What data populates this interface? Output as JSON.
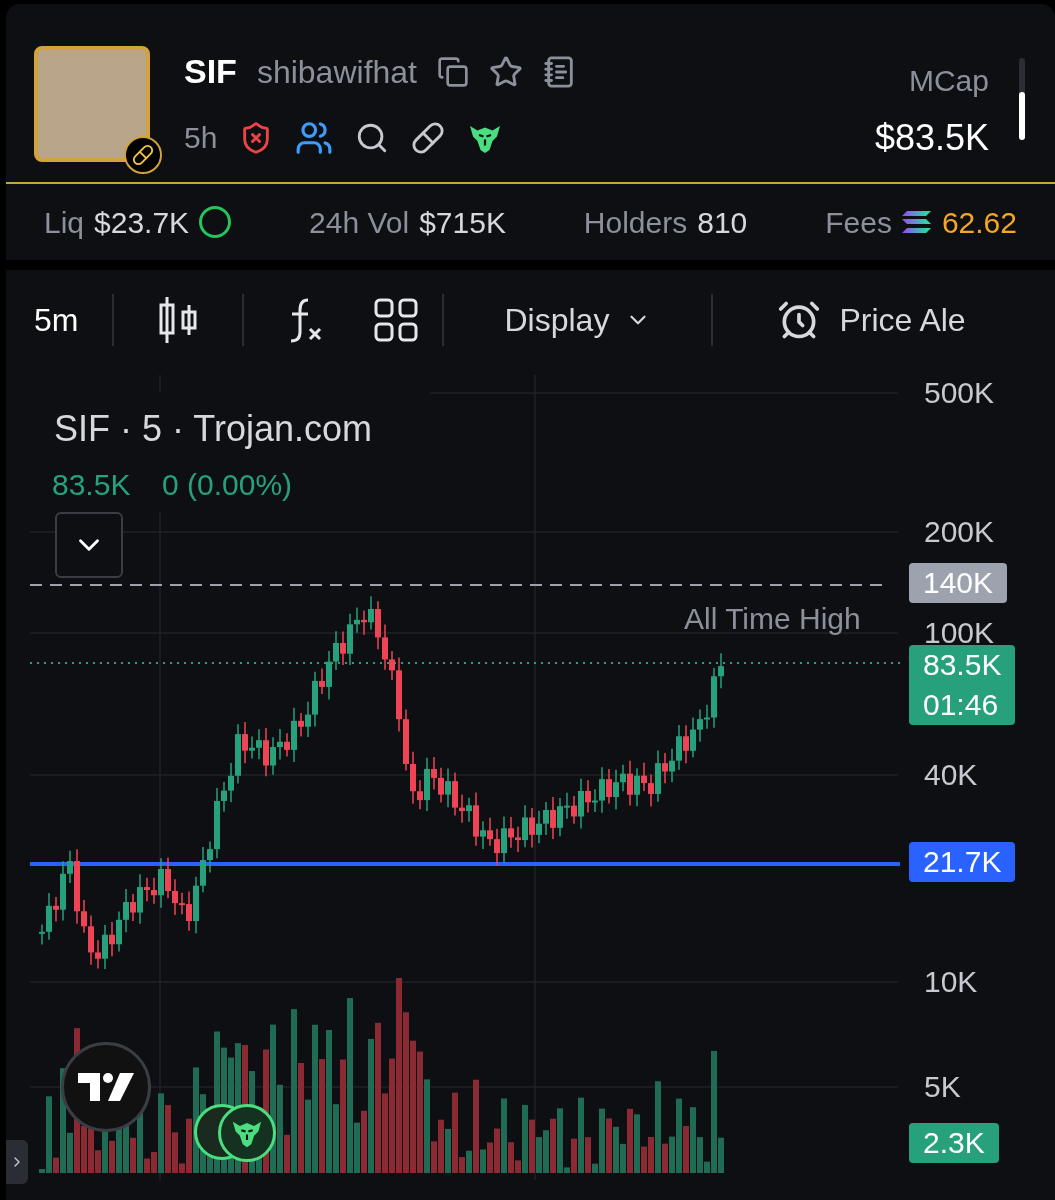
{
  "token": {
    "symbol": "SIF",
    "name": "shibawifhat",
    "age": "5h"
  },
  "mcap": {
    "label": "MCap",
    "value": "$83.5K"
  },
  "stats": [
    {
      "label": "Liq",
      "value": "$23.7K",
      "kind": "liq"
    },
    {
      "label": "24h Vol",
      "value": "$715K",
      "kind": "plain"
    },
    {
      "label": "Holders",
      "value": "810",
      "kind": "plain"
    },
    {
      "label": "Fees",
      "value": "62.62",
      "kind": "fees"
    }
  ],
  "toolbar": {
    "interval": "5m",
    "display": "Display",
    "alert": "Price Ale"
  },
  "chart": {
    "legend_title": "SIF · 5 · Trojan.com",
    "legend_value": "83.5K",
    "legend_change": "0 (0.00%)",
    "ath_label": "All Time High",
    "y_labels": [
      "500K",
      "200K",
      "100K",
      "40K",
      "10K",
      "5K"
    ],
    "tags": [
      {
        "text": "140K",
        "kind": "ath"
      },
      {
        "text": "83.5K",
        "sub": "01:46",
        "kind": "last"
      },
      {
        "text": "21.7K",
        "kind": "line"
      },
      {
        "text": "2.3K",
        "kind": "volume"
      }
    ]
  }
}
